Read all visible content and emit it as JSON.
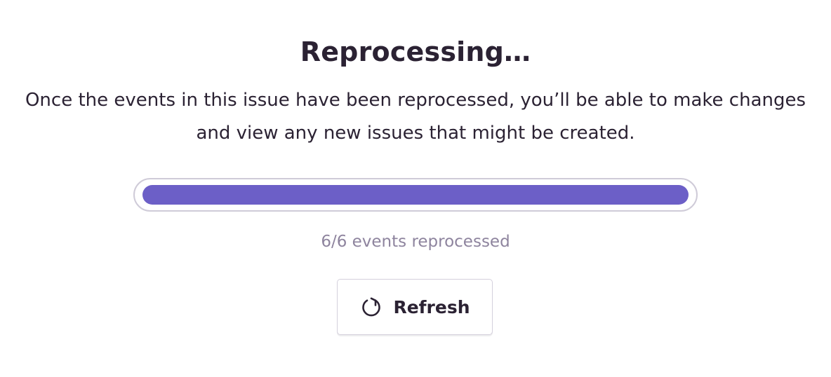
{
  "heading": {
    "title": "Reprocessing…",
    "description": "Once the events in this issue have been reprocessed, you’ll be able to make changes and view any new issues that might be created."
  },
  "progress": {
    "fraction": 1.0,
    "processed": 6,
    "total": 6,
    "status_text": "6/6 events reprocessed",
    "fill_color": "#6c5fc7",
    "track_border_color": "#cfcbd8"
  },
  "actions": {
    "refresh": {
      "label": "Refresh",
      "icon": "refresh-icon"
    }
  }
}
